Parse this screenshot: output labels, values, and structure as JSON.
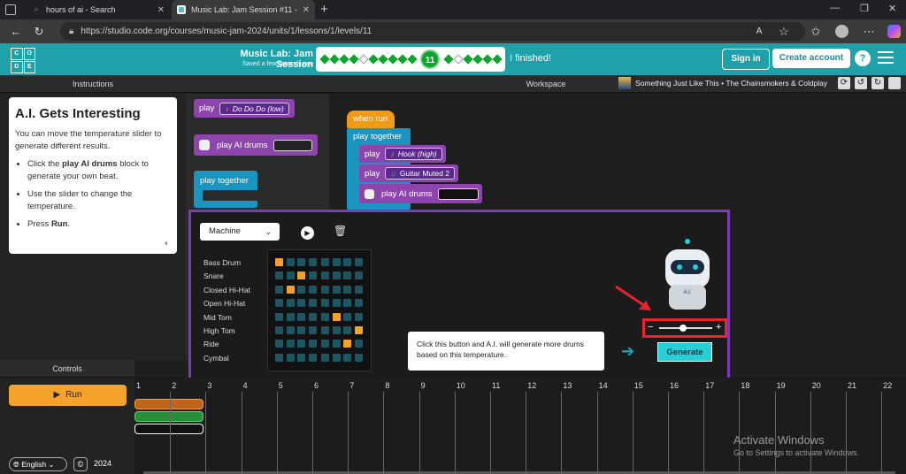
{
  "browser": {
    "tabs": [
      {
        "title": "hours of ai - Search",
        "icon": "bing-search-icon"
      },
      {
        "title": "Music Lab: Jam Session #11 - Coc",
        "icon": "code-org-icon"
      }
    ],
    "url": "https://studio.code.org/courses/music-jam-2024/units/1/lessons/1/levels/11"
  },
  "header": {
    "logo_letters": [
      "C",
      "O",
      "D",
      "E"
    ],
    "title": "Music Lab: Jam Session",
    "subtitle": "Saved a few seconds ago",
    "current_level": "11",
    "finished_label": "I finished!",
    "sign_in": "Sign in",
    "create_account": "Create account",
    "help": "?"
  },
  "instructions": {
    "panel_title": "Instructions",
    "heading": "A.I. Gets Interesting",
    "intro": "You can move the temperature slider to generate different results.",
    "bullet1_a": "Click the ",
    "bullet1_b": "play AI drums",
    "bullet1_c": " block to generate your own beat.",
    "bullet2": "Use the slider to change the temperature.",
    "bullet3_a": "Press ",
    "bullet3_b": "Run",
    "bullet3_c": "."
  },
  "workspace": {
    "panel_title": "Workspace",
    "song": "Something Just Like This • The Chainsmokers & Coldplay",
    "toolbox": {
      "play": "play",
      "play_sound": "Do Do Do (low)",
      "play_ai_drums": "play AI drums",
      "play_together": "play together"
    },
    "program": {
      "when_run": "when run",
      "play_together": "play together",
      "play": "play",
      "sound1": "Hook (high)",
      "sound2": "Guitar Muted 2",
      "play_ai_drums": "play AI drums"
    }
  },
  "drum_popup": {
    "kit": "Machine",
    "tracks": [
      "Bass Drum",
      "Snare",
      "Closed Hi-Hat",
      "Open Hi-Hat",
      "Mid Tom",
      "High Tom",
      "Ride",
      "Cymbal"
    ],
    "pattern": [
      [
        0
      ],
      [
        2
      ],
      [
        1
      ],
      [],
      [
        5
      ],
      [
        7
      ],
      [
        6
      ],
      []
    ],
    "temperature": 0.45,
    "robot_label": "A.I.",
    "callout": "Click this button and A.I. will generate more drums based on this temperature.",
    "generate": "Generate",
    "minus": "−",
    "plus": "+"
  },
  "controls": {
    "panel_title": "Controls",
    "run": "Run",
    "language": "English",
    "year": "2024",
    "bars": [
      "1",
      "2",
      "3",
      "4",
      "5",
      "6",
      "7",
      "8",
      "9",
      "10",
      "11",
      "12",
      "13",
      "14",
      "15",
      "16",
      "17",
      "18",
      "19",
      "20",
      "21",
      "22"
    ]
  },
  "watermark": {
    "line1": "Activate Windows",
    "line2": "Go to Settings to activate Windows."
  },
  "colors": {
    "accent": "#1fa1aa",
    "purple": "#7b3ab8",
    "orange": "#f3a22b",
    "teal": "#26d0d9"
  }
}
